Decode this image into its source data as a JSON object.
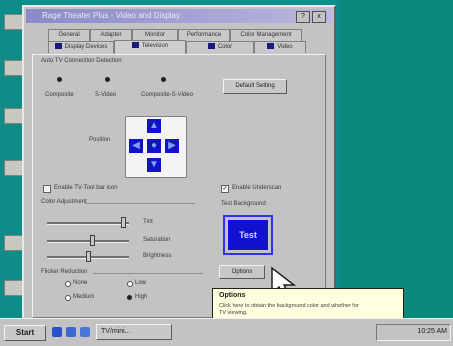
{
  "window": {
    "title": "Rage Theater Plus - Video and Display",
    "help_glyph": "?",
    "close_glyph": "x"
  },
  "tabs_row1": [
    "General",
    "Adapter",
    "Monitor",
    "Performance",
    "Color Management"
  ],
  "tabs_row2": [
    "Display Devices",
    "Television",
    "Color",
    "Video"
  ],
  "tv_detection": {
    "group_label": "Auto TV Connection Detection",
    "options": [
      "Composite",
      "S-Video",
      "Composite-S-Video"
    ],
    "default_button": "Default Setting"
  },
  "position": {
    "label": "Position",
    "up_glyph": "▲",
    "down_glyph": "▼",
    "left_glyph": "◀",
    "right_glyph": "▶",
    "center_glyph": "●"
  },
  "checkboxes": {
    "tvout_icon": "Enable TV-Tool bar icon",
    "underscan": "Enable Underscan"
  },
  "color_adjustment": {
    "label": "Color Adjustment",
    "sliders": [
      {
        "label": "Tint",
        "value": 0.95
      },
      {
        "label": "Saturation",
        "value": 0.55
      },
      {
        "label": "Brightness",
        "value": 0.5
      }
    ]
  },
  "test_background": {
    "label": "Test Background",
    "swatch_text": "Test",
    "options_button": "Options",
    "swatch_color": "#1010d0"
  },
  "flicker_reduction": {
    "label": "Flicker Reduction",
    "options": [
      "None",
      "Low",
      "Medium",
      "High"
    ]
  },
  "tooltip": {
    "title": "Options",
    "body": "Click here to obtain the background color and whether for TV viewing."
  },
  "taskbar": {
    "start": "Start",
    "task": "TV/mini...",
    "clock": "10:25 AM"
  }
}
